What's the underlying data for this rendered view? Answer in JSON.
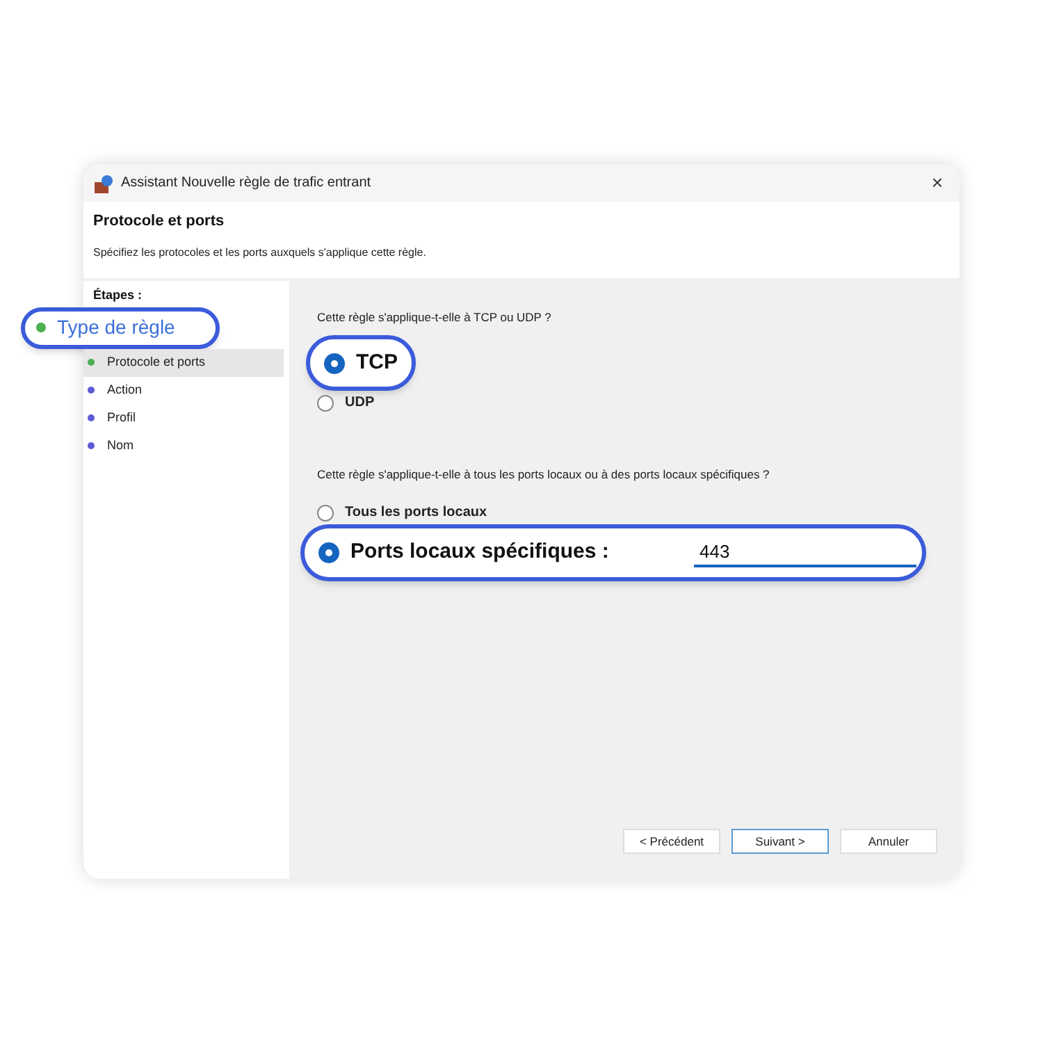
{
  "window": {
    "title": "Assistant Nouvelle règle de trafic entrant",
    "close": "×"
  },
  "header": {
    "title": "Protocole et ports",
    "subtitle": "Spécifiez les protocoles et les ports auxquels s'applique cette règle."
  },
  "steps_label": "Étapes :",
  "steps": [
    {
      "label": "Type de règle",
      "color": "#4caf50",
      "selected": false,
      "highlighted": true
    },
    {
      "label": "Protocole et ports",
      "color": "#4caf50",
      "selected": true,
      "highlighted": false
    },
    {
      "label": "Action",
      "color": "#5b5bd6",
      "selected": false,
      "highlighted": false
    },
    {
      "label": "Profil",
      "color": "#5b5bd6",
      "selected": false,
      "highlighted": false
    },
    {
      "label": "Nom",
      "color": "#5b5bd6",
      "selected": false,
      "highlighted": false
    }
  ],
  "protocol": {
    "question": "Cette règle s'applique-t-elle à TCP ou UDP ?",
    "options": [
      {
        "label": "TCP",
        "selected": true,
        "highlighted": true
      },
      {
        "label": "UDP",
        "selected": false,
        "highlighted": false
      }
    ]
  },
  "ports": {
    "question": "Cette règle s'applique-t-elle à tous les ports locaux ou à des ports locaux spécifiques ?",
    "options": [
      {
        "label": "Tous les ports locaux",
        "selected": false,
        "highlighted": false
      },
      {
        "label": "Ports locaux spécifiques :",
        "selected": true,
        "highlighted": true,
        "value": "443"
      }
    ]
  },
  "buttons": [
    {
      "label": "< Précédent",
      "focused": false
    },
    {
      "label": "Suivant >",
      "focused": true
    },
    {
      "label": "Annuler",
      "focused": false
    }
  ]
}
